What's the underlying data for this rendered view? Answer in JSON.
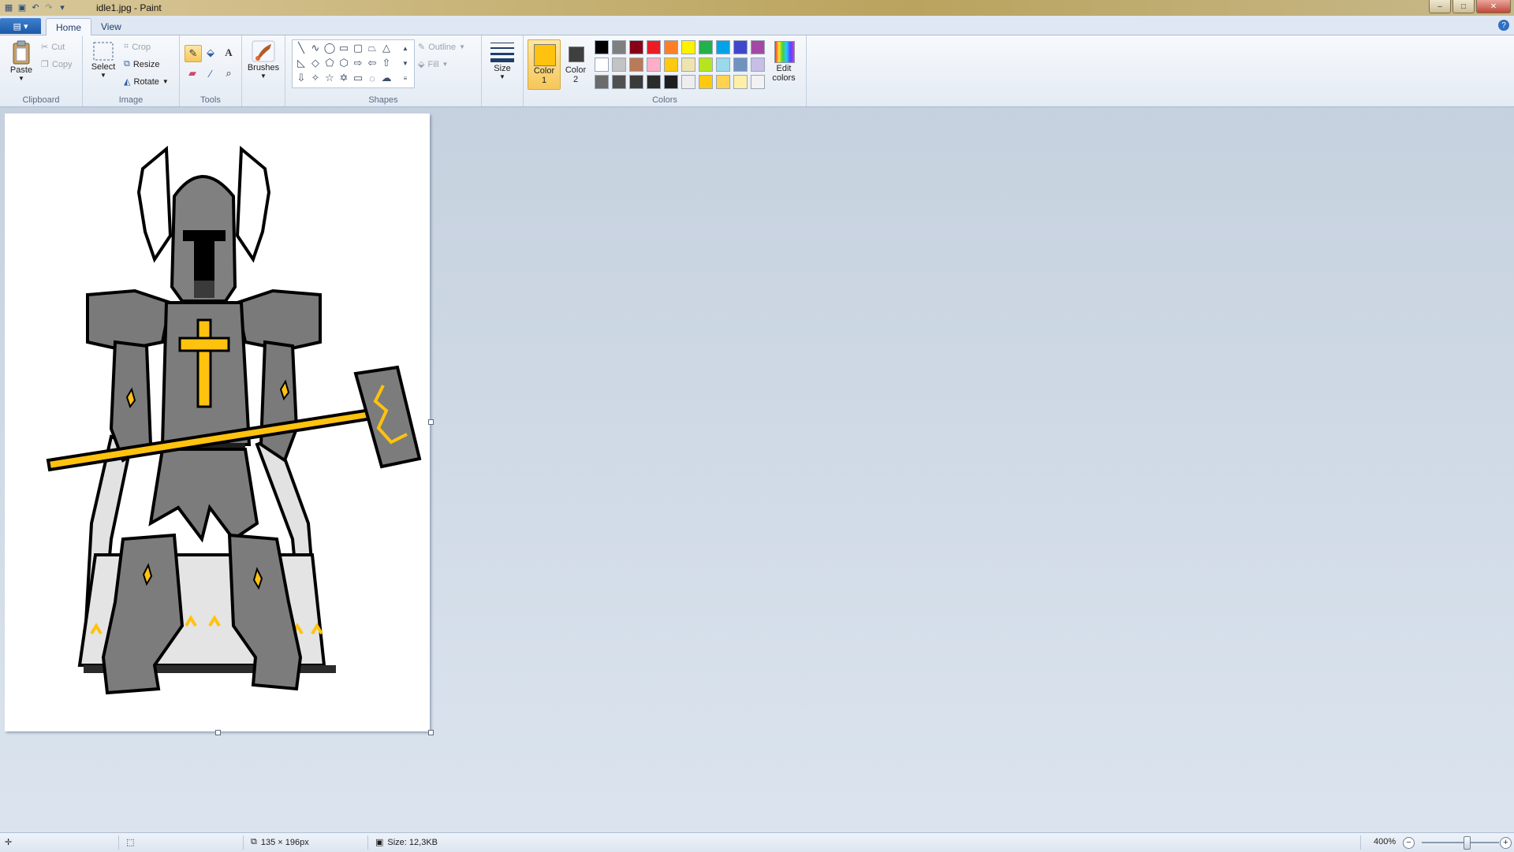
{
  "window": {
    "title": "idle1.jpg - Paint",
    "buttons": {
      "minimize": "–",
      "maximize": "□",
      "close": "✕"
    }
  },
  "ribbon_tabs": [
    {
      "label": "Home",
      "active": true
    },
    {
      "label": "View",
      "active": false
    }
  ],
  "clipboard": {
    "paste": "Paste",
    "cut": "Cut",
    "copy": "Copy",
    "label": "Clipboard"
  },
  "image": {
    "select": "Select",
    "crop": "Crop",
    "resize": "Resize",
    "rotate": "Rotate",
    "label": "Image"
  },
  "tools": {
    "label": "Tools"
  },
  "brushes": {
    "label": "Brushes"
  },
  "shapes": {
    "outline": "Outline",
    "fill": "Fill",
    "label": "Shapes"
  },
  "size": {
    "label": "Size"
  },
  "colors": {
    "color1_label": "Color 1",
    "color1_line1": "Color",
    "color1_line2": "1",
    "color2_line1": "Color",
    "color2_line2": "2",
    "color1_value": "#ffc20e",
    "color2_value": "#3f3f3f",
    "edit_line1": "Edit",
    "edit_line2": "colors",
    "label": "Colors",
    "palette_row1": [
      "#000000",
      "#7f7f7f",
      "#880015",
      "#ed1c24",
      "#ff7f27",
      "#fff200",
      "#22b14c",
      "#00a2e8",
      "#3f48cc",
      "#a349a4"
    ],
    "palette_row2": [
      "#ffffff",
      "#c3c3c3",
      "#b97a57",
      "#ffaec9",
      "#ffc90e",
      "#efe4b0",
      "#b5e61d",
      "#99d9ea",
      "#7092be",
      "#c8bfe7"
    ],
    "palette_row3": [
      "#6b6b6b",
      "#4f4f4f",
      "#3b3b3b",
      "#2b2b2b",
      "#1e1e1e",
      "#ededed",
      "#ffc90e",
      "#ffd34f",
      "#fff0a8",
      "#f2f2f2"
    ]
  },
  "status": {
    "dimensions": "135 × 196px",
    "file_size": "Size: 12,3KB",
    "zoom": "400%",
    "zoom_level_percent": 400
  }
}
